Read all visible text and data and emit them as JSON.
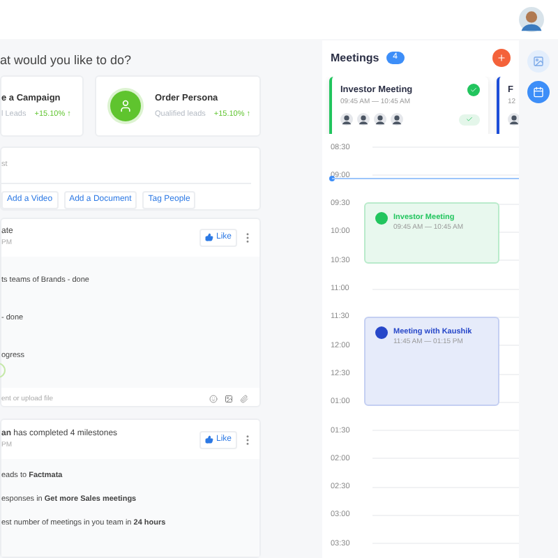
{
  "prompt": "at would you like to do?",
  "actions": [
    {
      "kind": "cut",
      "title": "e a Campaign",
      "subtitle": "l Leads",
      "change": "+15.10% ↑"
    },
    {
      "kind": "icon",
      "title": "Order Persona",
      "subtitle": "Qualified leads",
      "change": "+15.10% ↑"
    }
  ],
  "composer": {
    "placeholder": "st",
    "buttons": [
      "Add a Video",
      "Add a Document",
      "Tag People"
    ]
  },
  "posts": [
    {
      "title": "ate",
      "time": "PM",
      "like": "Like",
      "lines": [
        "ts teams of Brands - done",
        "- done",
        "ogress"
      ],
      "progress_ring": true,
      "comment_placeholder": "ent or upload file"
    },
    {
      "title": "**an** has completed 4 milestones",
      "time": "PM",
      "like": "Like",
      "lines": [
        "eads to **Factmata**",
        "esponses in **Get more Sales meetings**",
        "est number of meetings in you team in **24 hours**"
      ],
      "progress_ring": false
    }
  ],
  "meetings": {
    "title": "Meetings",
    "count": "4",
    "cards": [
      {
        "title": "Investor Meeting",
        "time": "09:45 AM — 10:45 AM",
        "color": "#22c55e",
        "done": true
      },
      {
        "title": "F",
        "time": "12",
        "color": "#1d4ed8"
      }
    ],
    "times": [
      "08:30",
      "09:00",
      "09:30",
      "10:00",
      "10:30",
      "11:00",
      "11:30",
      "12:00",
      "12:30",
      "01:00",
      "01:30",
      "02:00",
      "02:30",
      "03:00",
      "03:30"
    ],
    "events": [
      {
        "title": "Investor Meeting",
        "time": "09:45 AM — 10:45 AM",
        "kind": "green"
      },
      {
        "title": "Meeting with Kaushik",
        "time": "11:45 AM — 01:15 PM",
        "kind": "blue"
      }
    ]
  }
}
